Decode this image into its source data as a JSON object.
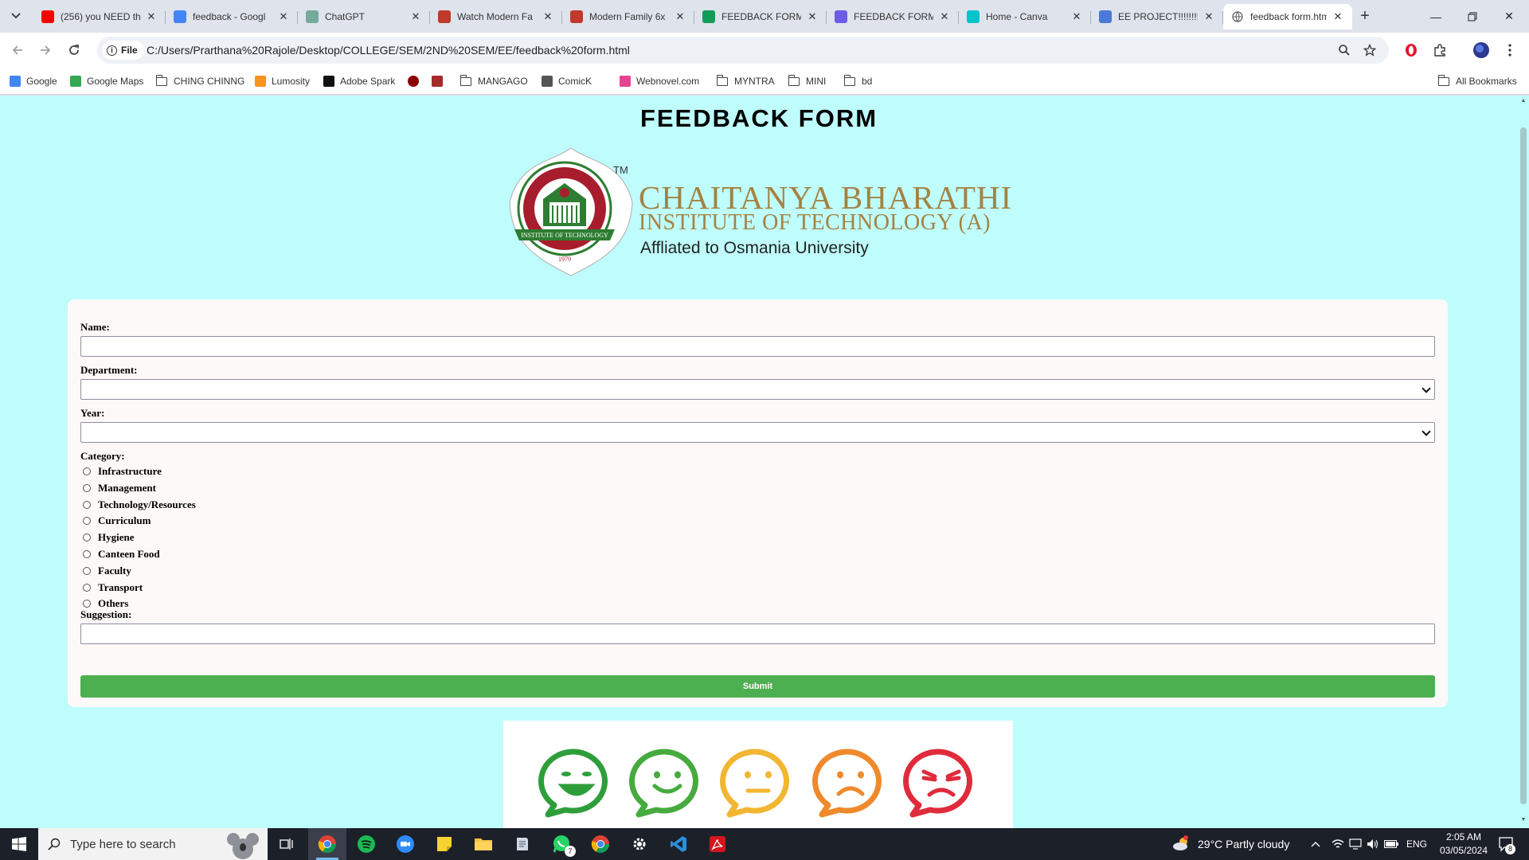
{
  "tabs": [
    {
      "title": "(256) you NEED th",
      "icon": "youtube-icon",
      "color": "#ff0000"
    },
    {
      "title": "feedback - Googl",
      "icon": "google-icon",
      "color": "#4285f4"
    },
    {
      "title": "ChatGPT",
      "icon": "chatgpt-icon",
      "color": "#74aa9c"
    },
    {
      "title": "Watch Modern Fa",
      "icon": "fa-icon",
      "color": "#c0392b"
    },
    {
      "title": "Modern Family 6x",
      "icon": "fa-icon",
      "color": "#c0392b"
    },
    {
      "title": "FEEDBACK FORM",
      "icon": "google-sheets-icon",
      "color": "#0f9d58"
    },
    {
      "title": "FEEDBACK FORM",
      "icon": "pen-icon",
      "color": "#6c5ce7"
    },
    {
      "title": "Home - Canva",
      "icon": "canva-icon",
      "color": "#00c4cc"
    },
    {
      "title": "EE PROJECT!!!!!!!!",
      "icon": "project-icon",
      "color": "#4a7bd8"
    },
    {
      "title": "feedback form.htm",
      "icon": "globe-icon",
      "color": "#5f6368"
    }
  ],
  "address": {
    "chip": "File",
    "url": "C:/Users/Prarthana%20Rajole/Desktop/COLLEGE/SEM/2ND%20SEM/EE/feedback%20form.html"
  },
  "bookmarks": [
    {
      "label": "Google",
      "type": "site"
    },
    {
      "label": "Google Maps",
      "type": "site"
    },
    {
      "label": "CHING CHINNG",
      "type": "folder"
    },
    {
      "label": "Lumosity",
      "type": "site"
    },
    {
      "label": "Adobe Spark",
      "type": "site"
    },
    {
      "label": "",
      "type": "site"
    },
    {
      "label": "",
      "type": "site"
    },
    {
      "label": "MANGAGO",
      "type": "folder"
    },
    {
      "label": "ComicK",
      "type": "site"
    },
    {
      "label": "Webnovel.com",
      "type": "site"
    },
    {
      "label": "MYNTRA",
      "type": "folder"
    },
    {
      "label": "MINI",
      "type": "folder"
    },
    {
      "label": "bd",
      "type": "folder"
    },
    {
      "label": "All Bookmarks",
      "type": "folder"
    }
  ],
  "page": {
    "title": "FEEDBACK FORM",
    "logo": {
      "line1": "CHAITANYA BHARATHI",
      "line2": "INSTITUTE OF TECHNOLOGY (A)",
      "line3": "Affliated to Osmania University",
      "tm": "TM",
      "seal_ring": "CHAITANYA BHARATHI",
      "seal_banner": "INSTITUTE OF TECHNOLOGY",
      "seal_year": "1979"
    },
    "form": {
      "name_label": "Name:",
      "name_value": "",
      "department_label": "Department:",
      "department_value": "",
      "year_label": "Year:",
      "year_value": "",
      "category_label": "Category:",
      "categories": [
        "Infrastructure",
        "Management",
        "Technology/Resources",
        "Curriculum",
        "Hygiene",
        "Canteen Food",
        "Faculty",
        "Transport",
        "Others"
      ],
      "suggestion_label": "Suggestion:",
      "suggestion_value": "",
      "submit_label": "Submit"
    },
    "ratings": [
      {
        "name": "very-happy",
        "color": "#2e9e3a"
      },
      {
        "name": "happy",
        "color": "#46ab3e"
      },
      {
        "name": "neutral",
        "color": "#f2b632"
      },
      {
        "name": "sad",
        "color": "#ef8a2c"
      },
      {
        "name": "angry",
        "color": "#e02b3c"
      }
    ]
  },
  "taskbar": {
    "search_placeholder": "Type here to search",
    "weather": "29°C  Partly cloudy",
    "language": "ENG",
    "time": "2:05 AM",
    "date": "03/05/2024",
    "whatsapp_badge": "7",
    "notification_count": "8"
  },
  "colors": {
    "page_bg": "#bffcfc",
    "card_bg": "#fdf9f8",
    "submit": "#4caf50",
    "logo_gold": "#a38342"
  }
}
